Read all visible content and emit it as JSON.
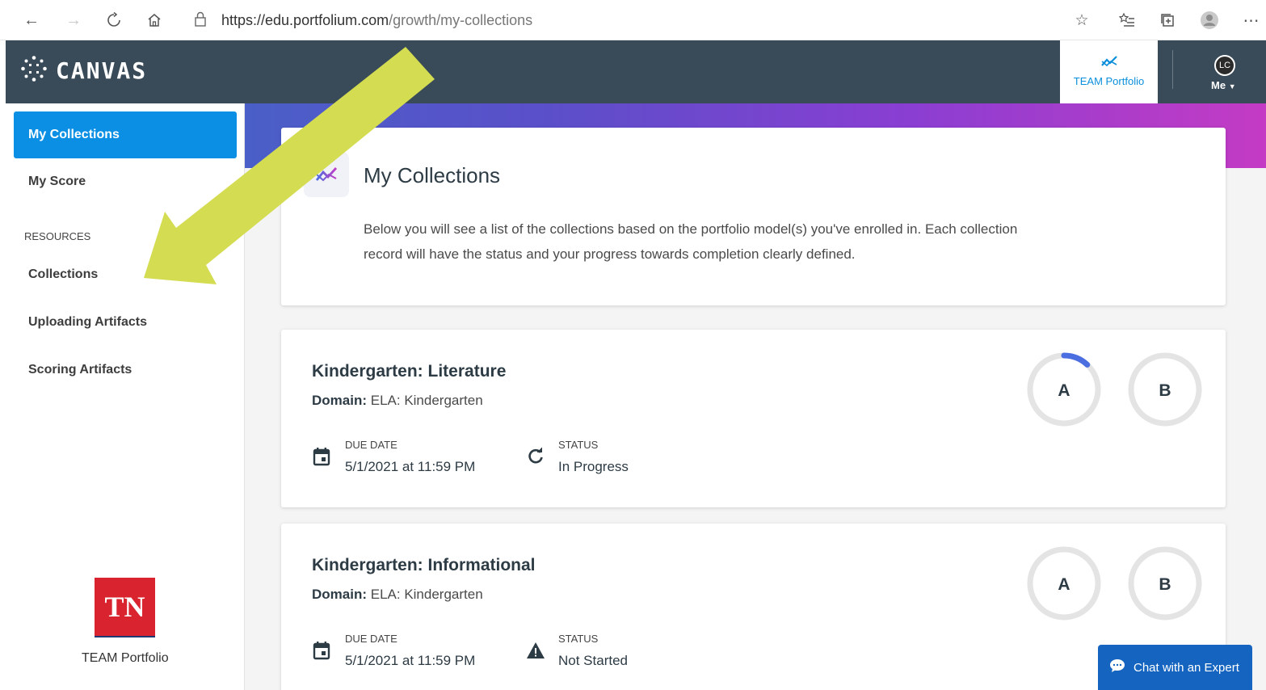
{
  "browser": {
    "url_host": "https://edu.portfolium.com",
    "url_path": "/growth/my-collections"
  },
  "header": {
    "logo_text": "CANVAS",
    "team_portfolio_label": "TEAM Portfolio",
    "user_initials": "LC",
    "user_menu_label": "Me"
  },
  "sidebar": {
    "items": [
      {
        "label": "My Collections"
      },
      {
        "label": "My Score"
      }
    ],
    "resources_heading": "RESOURCES",
    "resources": [
      {
        "label": "Collections"
      },
      {
        "label": "Uploading Artifacts"
      },
      {
        "label": "Scoring Artifacts"
      }
    ],
    "footer_logo_text": "TN",
    "footer_caption": "TEAM Portfolio"
  },
  "intro": {
    "title": "My Collections",
    "description": "Below you will see a list of the collections based on the portfolio model(s) you've enrolled in. Each collection record will have the status and your progress towards completion clearly defined."
  },
  "collections": [
    {
      "title": "Kindergarten: Literature",
      "domain_label": "Domain:",
      "domain_value": "ELA: Kindergarten",
      "due_label": "DUE DATE",
      "due_value": "5/1/2021 at 11:59 PM",
      "status_label": "STATUS",
      "status_value": "In Progress",
      "status_icon": "refresh-icon",
      "ring_a": "A",
      "ring_b": "B",
      "ring_a_progress": 0.12,
      "ring_b_progress": 0
    },
    {
      "title": "Kindergarten: Informational",
      "domain_label": "Domain:",
      "domain_value": "ELA: Kindergarten",
      "due_label": "DUE DATE",
      "due_value": "5/1/2021 at 11:59 PM",
      "status_label": "STATUS",
      "status_value": "Not Started",
      "status_icon": "warning-icon",
      "ring_a": "A",
      "ring_b": "B",
      "ring_a_progress": 0,
      "ring_b_progress": 0
    }
  ],
  "chat": {
    "label": "Chat with an Expert"
  },
  "colors": {
    "canvas_header": "#394b58",
    "accent_blue": "#0b8fe4",
    "annotation_arrow": "#d4dc52",
    "ring_progress": "#4b6ee0"
  }
}
